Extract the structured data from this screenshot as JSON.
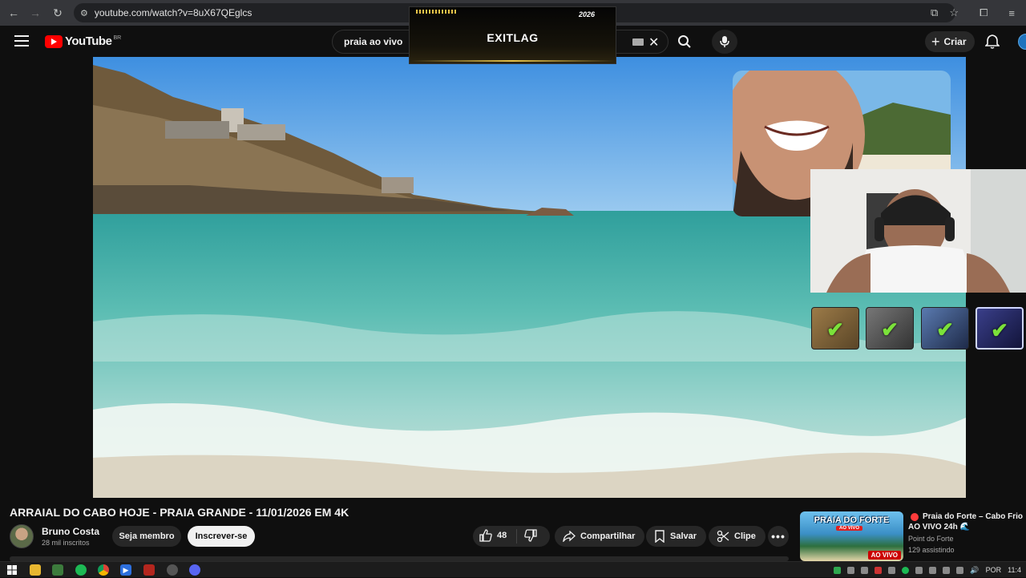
{
  "browser": {
    "url": "youtube.com/watch?v=8uX67QEglcs",
    "nav_icons": [
      "back-arrow-icon",
      "forward-arrow-icon",
      "reload-icon",
      "site-info-icon"
    ],
    "toolbar_icons": [
      "cast-icon",
      "bookmark-star-icon",
      "extensions-icon",
      "menu-icon"
    ]
  },
  "header": {
    "logo_text": "YouTube",
    "country_code": "BR",
    "search_query": "praia ao vivo",
    "create_label": "Criar"
  },
  "overlay": {
    "brand": "EXITLAG",
    "brand_bold": "EXIT",
    "brand_rest": "LAG",
    "badge": "2026"
  },
  "video": {
    "title": "ARRAIAL DO CABO HOJE - PRAIA GRANDE - 11/01/2026 EM 4K",
    "tiles_checked": 4
  },
  "channel": {
    "name": "Bruno Costa",
    "subscribers": "28 mil inscritos",
    "member_label": "Seja membro",
    "subscribe_label": "Inscrever-se"
  },
  "actions": {
    "likes": "48",
    "share_label": "Compartilhar",
    "save_label": "Salvar",
    "clip_label": "Clipe",
    "more_label": "•••"
  },
  "related": {
    "thumb_title": "PRAIA DO FORTE",
    "thumb_subtitle": "AO VIVO",
    "live_badge": "AO VIVO",
    "title_line1": "Praia do Forte – Cabo Frio",
    "title_line2": "AO VIVO 24h 🌊",
    "channel": "Point do Forte",
    "viewers": "129 assistindo"
  },
  "taskbar": {
    "apps": [
      "windows-start-icon",
      "file-explorer-icon",
      "shield-app-icon",
      "spotify-icon",
      "chrome-icon",
      "media-player-icon",
      "calendar-app-icon",
      "settings-app-icon",
      "discord-icon"
    ],
    "language": "POR",
    "time": "11:4"
  },
  "colors": {
    "yt_red": "#ff0000",
    "background": "#0f0f0f",
    "pill": "#272727",
    "check_green": "#7be23a"
  }
}
